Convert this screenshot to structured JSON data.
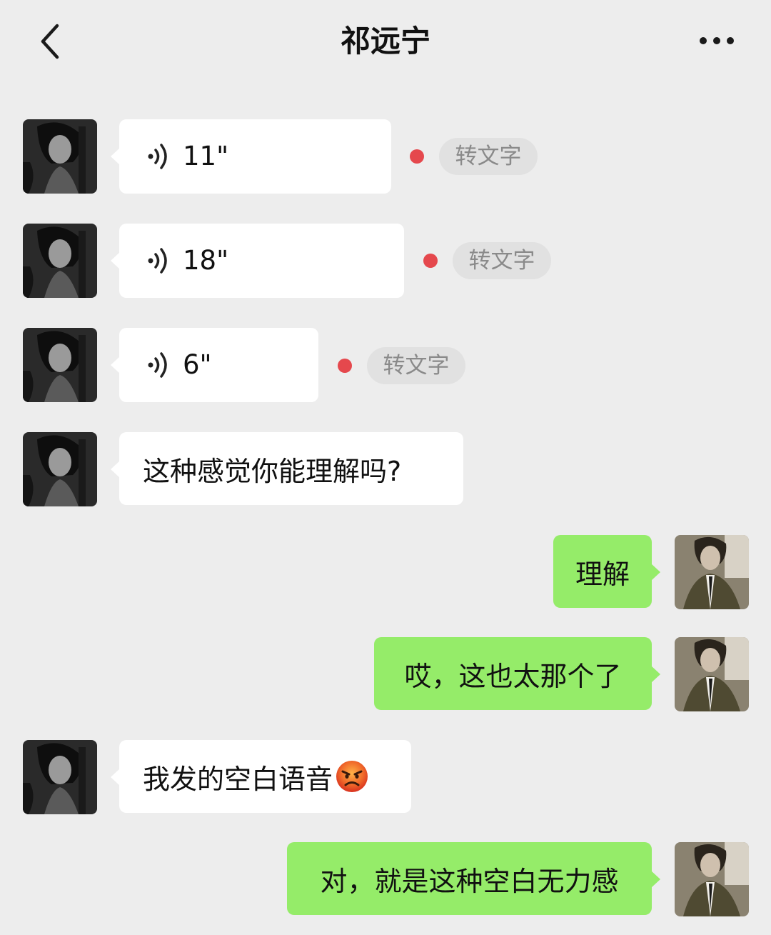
{
  "header": {
    "title": "祁远宁",
    "back_icon": "chevron-left-icon",
    "more_icon": "ellipsis-icon"
  },
  "colors": {
    "background": "#ededed",
    "incoming_bubble": "#ffffff",
    "outgoing_bubble": "#95ec69",
    "unread_dot": "#e5484d",
    "transcribe_bg": "#e1e1e1"
  },
  "messages": [
    {
      "type": "voice",
      "side": "left",
      "duration": "11\"",
      "transcribe_label": "转文字",
      "unread": true
    },
    {
      "type": "voice",
      "side": "left",
      "duration": "18\"",
      "transcribe_label": "转文字",
      "unread": true
    },
    {
      "type": "voice",
      "side": "left",
      "duration": "6\"",
      "transcribe_label": "转文字",
      "unread": true
    },
    {
      "type": "text",
      "side": "left",
      "text": "这种感觉你能理解吗?"
    },
    {
      "type": "text",
      "side": "right",
      "text": "理解"
    },
    {
      "type": "text",
      "side": "right",
      "text": "哎，这也太那个了"
    },
    {
      "type": "text",
      "side": "left",
      "text": "我发的空白语音",
      "emoji": "angry-face-emoji"
    },
    {
      "type": "text",
      "side": "right",
      "text": "对，就是这种空白无力感"
    }
  ]
}
